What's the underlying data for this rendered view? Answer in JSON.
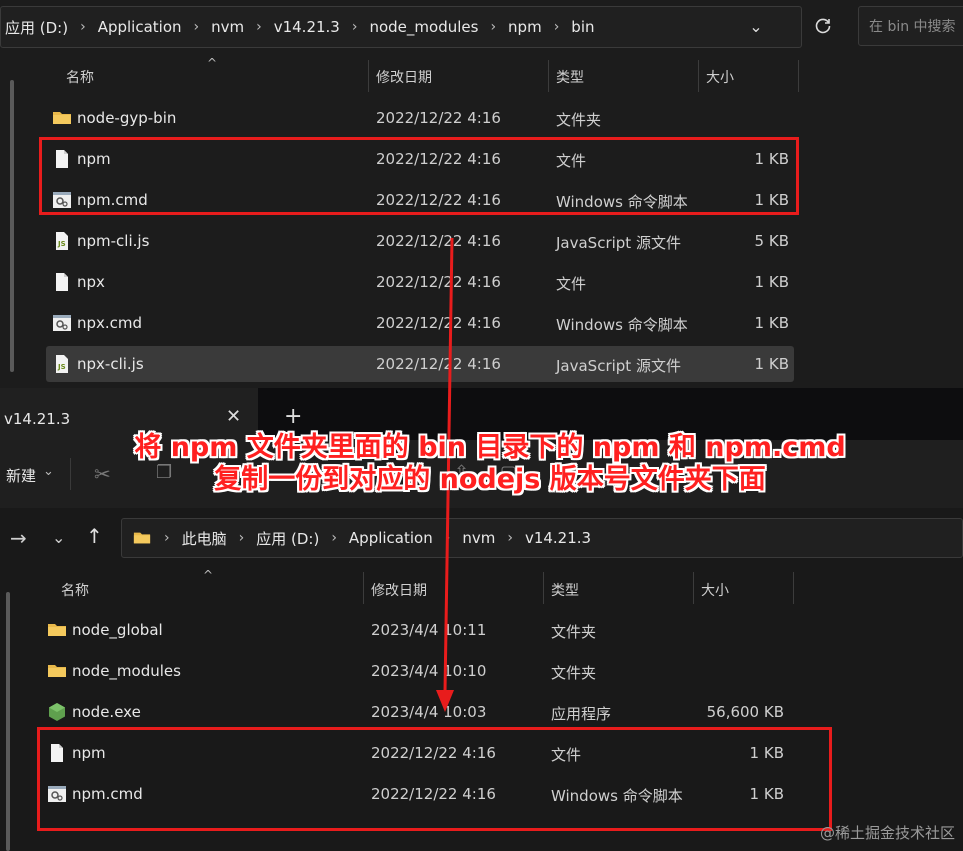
{
  "top": {
    "breadcrumb": [
      "应用 (D:)",
      "Application",
      "nvm",
      "v14.21.3",
      "node_modules",
      "npm",
      "bin"
    ],
    "search_placeholder": "在 bin 中搜索",
    "columns": {
      "name": "名称",
      "date": "修改日期",
      "type": "类型",
      "size": "大小"
    },
    "rows": [
      {
        "name": "node-gyp-bin",
        "date": "2022/12/22 4:16",
        "type": "文件夹",
        "size": "",
        "icon": "folder-icon"
      },
      {
        "name": "npm",
        "date": "2022/12/22 4:16",
        "type": "文件",
        "size": "1 KB",
        "icon": "file-icon"
      },
      {
        "name": "npm.cmd",
        "date": "2022/12/22 4:16",
        "type": "Windows 命令脚本",
        "size": "1 KB",
        "icon": "cmd-script-icon"
      },
      {
        "name": "npm-cli.js",
        "date": "2022/12/22 4:16",
        "type": "JavaScript 源文件",
        "size": "5 KB",
        "icon": "js-file-icon"
      },
      {
        "name": "npx",
        "date": "2022/12/22 4:16",
        "type": "文件",
        "size": "1 KB",
        "icon": "file-icon"
      },
      {
        "name": "npx.cmd",
        "date": "2022/12/22 4:16",
        "type": "Windows 命令脚本",
        "size": "1 KB",
        "icon": "cmd-script-icon"
      },
      {
        "name": "npx-cli.js",
        "date": "2022/12/22 4:16",
        "type": "JavaScript 源文件",
        "size": "1 KB",
        "icon": "js-file-icon"
      }
    ]
  },
  "bottom": {
    "tab_title": "v14.21.3",
    "new_button": "新建",
    "breadcrumb": [
      "此电脑",
      "应用 (D:)",
      "Application",
      "nvm",
      "v14.21.3"
    ],
    "columns": {
      "name": "名称",
      "date": "修改日期",
      "type": "类型",
      "size": "大小"
    },
    "rows": [
      {
        "name": "node_global",
        "date": "2023/4/4 10:11",
        "type": "文件夹",
        "size": "",
        "icon": "folder-icon"
      },
      {
        "name": "node_modules",
        "date": "2023/4/4 10:10",
        "type": "文件夹",
        "size": "",
        "icon": "folder-icon"
      },
      {
        "name": "node.exe",
        "date": "2023/4/4 10:03",
        "type": "应用程序",
        "size": "56,600 KB",
        "icon": "nodejs-icon"
      },
      {
        "name": "npm",
        "date": "2022/12/22 4:16",
        "type": "文件",
        "size": "1 KB",
        "icon": "file-icon"
      },
      {
        "name": "npm.cmd",
        "date": "2022/12/22 4:16",
        "type": "Windows 命令脚本",
        "size": "1 KB",
        "icon": "cmd-script-icon"
      }
    ]
  },
  "annotation": {
    "line1": "将 npm 文件夹里面的 bin 目录下的 npm 和 npm.cmd",
    "line2": "复制一份到对应的 nodejs 版本号文件夹下面",
    "color": "#ff2020"
  },
  "watermark": "@稀土掘金技术社区"
}
